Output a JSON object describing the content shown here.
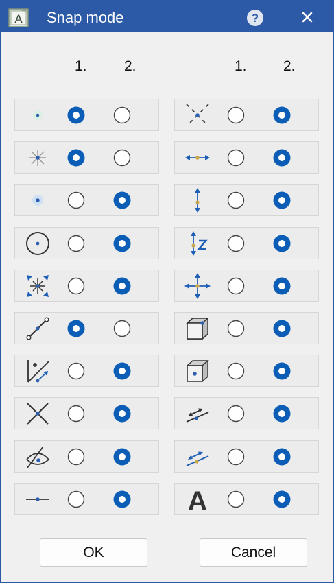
{
  "window": {
    "title": "Snap mode",
    "app_icon_letter": "A",
    "help_label": "?",
    "close_label": "✕",
    "accent_color": "#2c5aa6",
    "radio_selected_color": "#0b5db6"
  },
  "columns": {
    "left": {
      "col1": "1.",
      "col2": "2."
    },
    "right": {
      "col1": "1.",
      "col2": "2."
    }
  },
  "left_rows": [
    {
      "icon": "point-snap-icon",
      "selected": 1
    },
    {
      "icon": "endpoint-star-icon",
      "selected": 1
    },
    {
      "icon": "point-highlight-icon",
      "selected": 2
    },
    {
      "icon": "circle-center-icon",
      "selected": 2
    },
    {
      "icon": "intersection-arrows-icon",
      "selected": 2
    },
    {
      "icon": "line-segment-icon",
      "selected": 1
    },
    {
      "icon": "relative-offset-icon",
      "selected": 2
    },
    {
      "icon": "cross-intersection-icon",
      "selected": 2
    },
    {
      "icon": "eye-view-icon",
      "selected": 2
    },
    {
      "icon": "line-midpoint-icon",
      "selected": 2
    }
  ],
  "right_rows": [
    {
      "icon": "dashed-cross-icon",
      "selected": 2
    },
    {
      "icon": "horizontal-arrows-icon",
      "selected": 2
    },
    {
      "icon": "vertical-arrows-icon",
      "selected": 2
    },
    {
      "icon": "z-axis-arrows-icon",
      "selected": 2
    },
    {
      "icon": "four-way-arrows-icon",
      "selected": 2
    },
    {
      "icon": "cube-edge-point-icon",
      "selected": 2
    },
    {
      "icon": "cube-face-point-icon",
      "selected": 2
    },
    {
      "icon": "line-perpendicular-icon",
      "selected": 2
    },
    {
      "icon": "line-parallel-icon",
      "selected": 2
    },
    {
      "icon": "text-snap-icon",
      "selected": 2,
      "glyph": "A"
    }
  ],
  "buttons": {
    "ok": "OK",
    "cancel": "Cancel"
  }
}
